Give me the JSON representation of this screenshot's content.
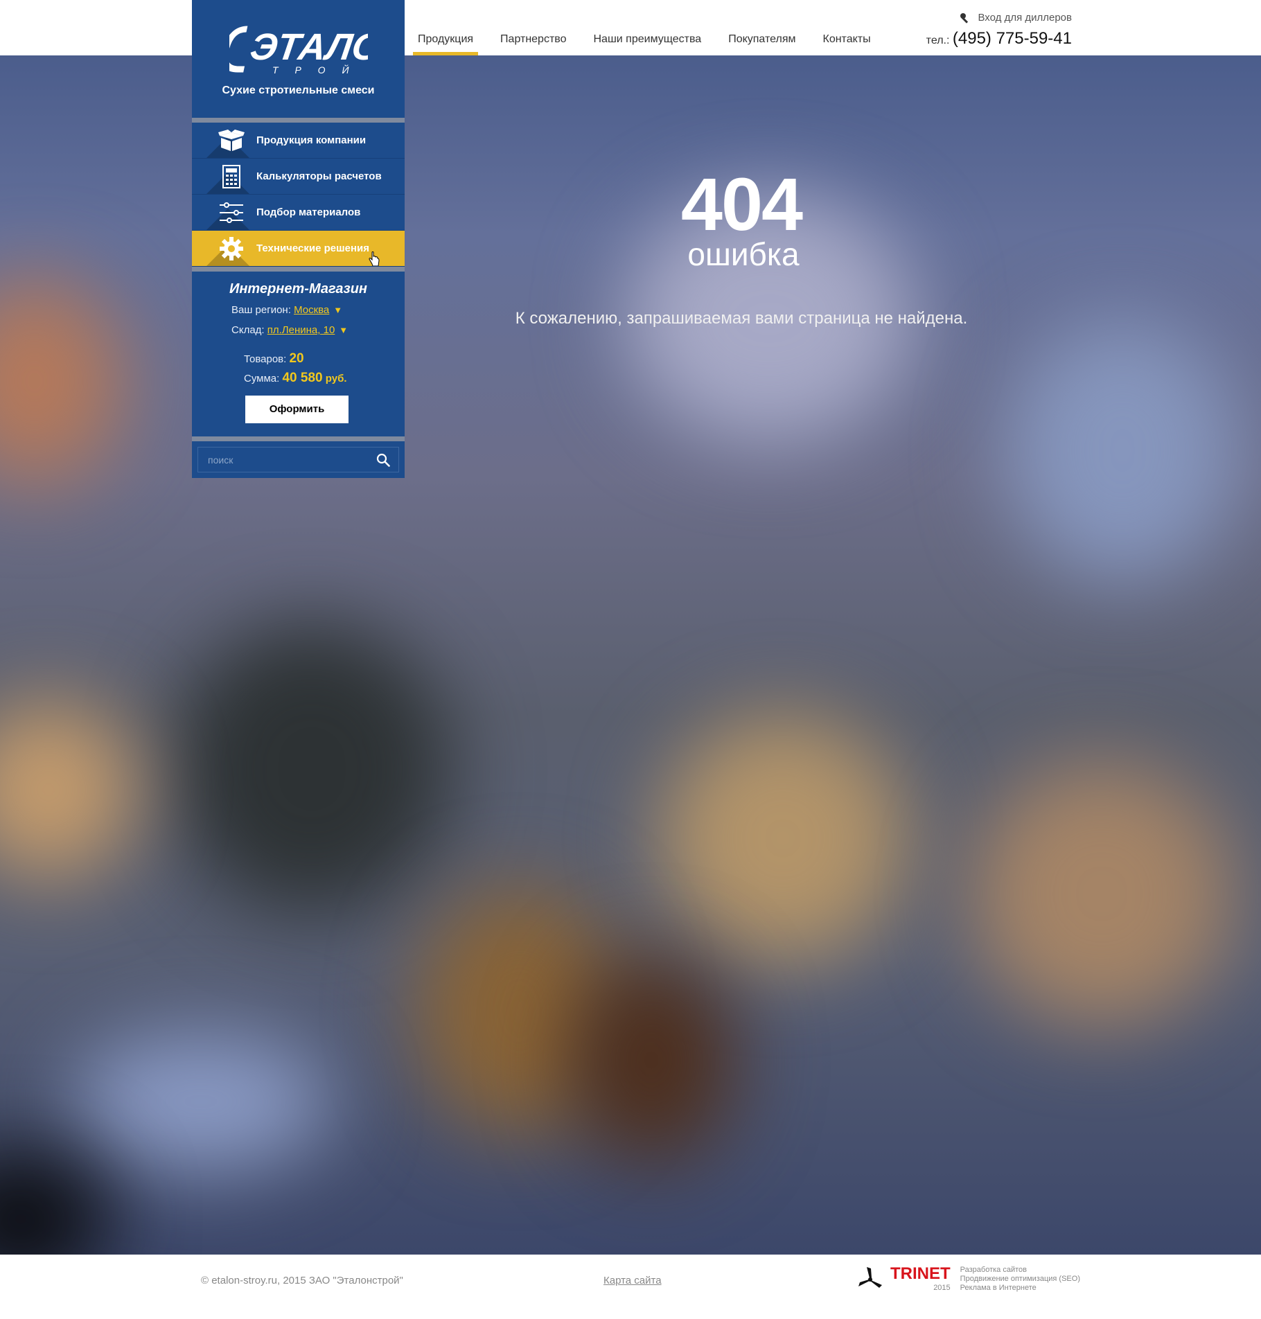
{
  "header": {
    "nav": [
      "Продукция",
      "Партнерство",
      "Наши преимущества",
      "Покупателям",
      "Контакты"
    ],
    "dealer_login": "Вход для диллеров",
    "phone_prefix": "тел.:",
    "phone_number": "(495) 775-59-41"
  },
  "sidebar": {
    "logo_text": "ЭТАЛОН",
    "logo_sub": "Т Р О Й",
    "tagline": "Сухие стротиельные смеси",
    "menu": [
      {
        "label": "Продукция компании",
        "icon": "box-icon"
      },
      {
        "label": "Калькуляторы расчетов",
        "icon": "calculator-icon"
      },
      {
        "label": "Подбор материалов",
        "icon": "sliders-icon"
      },
      {
        "label": "Технические решения",
        "icon": "gear-icon"
      }
    ],
    "shop": {
      "title": "Интернет-Магазин",
      "region_label": "Ваш регион:",
      "region_value": "Москва",
      "store_label": "Склад:",
      "store_value": "пл.Ленина, 10",
      "items_label": "Товаров:",
      "items_value": "20",
      "sum_label": "Сумма:",
      "sum_value": "40 580",
      "sum_currency": "руб.",
      "order_button": "Оформить"
    },
    "search_placeholder": "поиск"
  },
  "content": {
    "code": "404",
    "word": "ошибка",
    "message": "К сожалению, запрашиваемая вами страница не найдена."
  },
  "footer": {
    "copyright": "© etalon-stroy.ru, 2015 ЗАО \"Эталонстрой\"",
    "sitemap": "Карта сайта",
    "trinet_name": "TRINET",
    "trinet_year": "2015",
    "trinet_services": [
      "Разработка сайтов",
      "Продвижение оптимизация (SEO)",
      "Реклама в Интернете"
    ]
  },
  "colors": {
    "brand_blue": "#1d4c8c",
    "accent_yellow": "#e8b829",
    "trinet_red": "#d8141c"
  }
}
